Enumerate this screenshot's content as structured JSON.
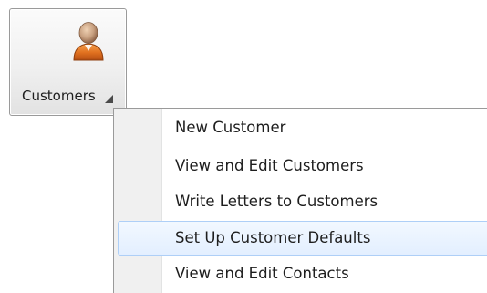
{
  "ribbon": {
    "customers_button": {
      "label": "Customers",
      "icon": "customer-person-icon"
    }
  },
  "menu": {
    "items": [
      {
        "label": "New Customer"
      },
      {
        "label": "View and Edit Customers"
      },
      {
        "label": "Write Letters to Customers"
      },
      {
        "label": "Set Up Customer Defaults",
        "highlighted": true
      },
      {
        "label": "View and Edit Contacts"
      }
    ]
  },
  "colors": {
    "icon_orange": "#e0701f",
    "icon_skin": "#c8a080",
    "highlight_border": "#aecff7",
    "highlight_fill": "#e3efff"
  }
}
